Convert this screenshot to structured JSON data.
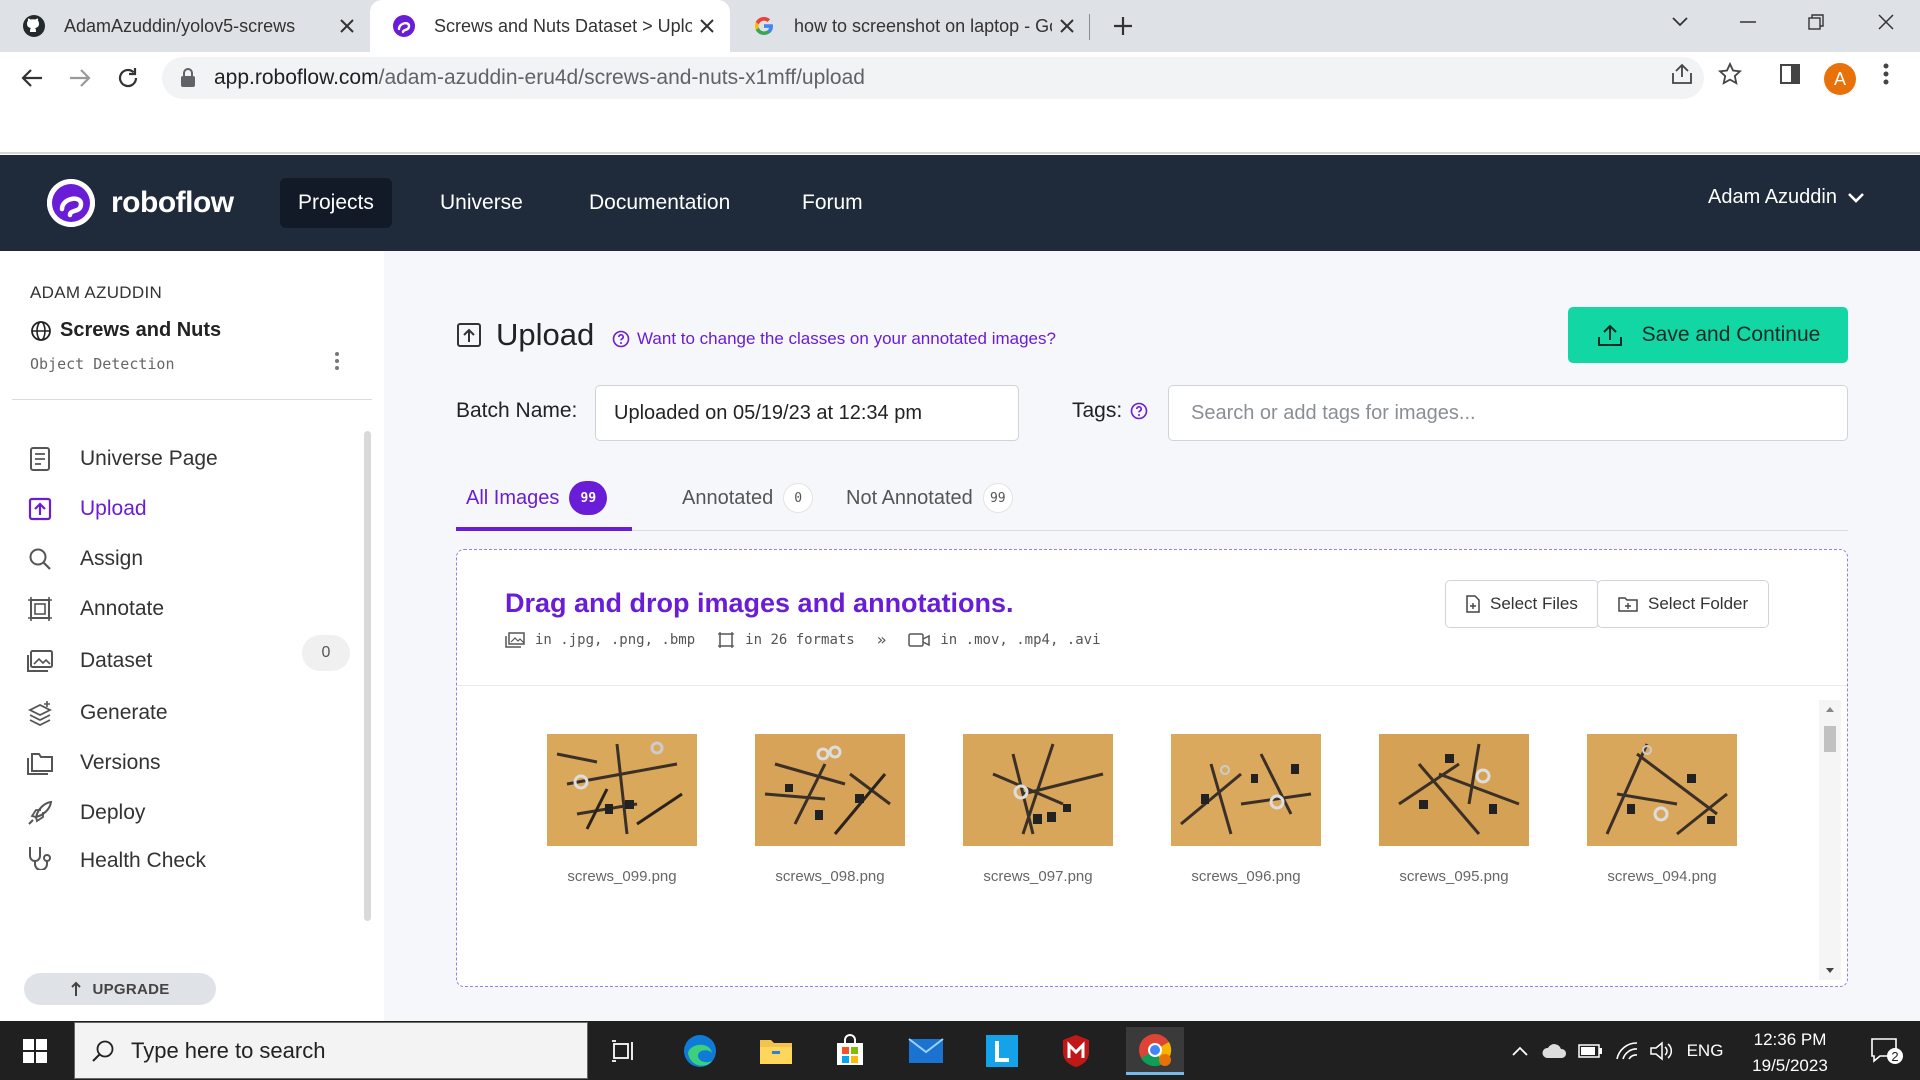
{
  "browser": {
    "tabs": [
      {
        "title": "AdamAzuddin/yolov5-screws",
        "icon": "github-icon"
      },
      {
        "title": "Screws and Nuts Dataset > Uplo…",
        "icon": "roboflow-icon"
      },
      {
        "title": "how to screenshot on laptop - Go",
        "icon": "google-icon"
      }
    ],
    "url_host": "app.roboflow.com",
    "url_path": "/adam-azuddin-eru4d/screws-and-nuts-x1mff/upload",
    "profile_initial": "A"
  },
  "nav": {
    "brand": "roboflow",
    "links": [
      "Projects",
      "Universe",
      "Documentation",
      "Forum"
    ],
    "user": "Adam Azuddin"
  },
  "sidebar": {
    "owner": "ADAM AZUDDIN",
    "project": "Screws and Nuts",
    "project_type": "Object Detection",
    "items": [
      {
        "label": "Universe Page",
        "icon": "book-icon"
      },
      {
        "label": "Upload",
        "icon": "upload-icon"
      },
      {
        "label": "Assign",
        "icon": "search-icon"
      },
      {
        "label": "Annotate",
        "icon": "annotate-icon"
      },
      {
        "label": "Dataset",
        "icon": "images-icon",
        "badge": "0"
      },
      {
        "label": "Generate",
        "icon": "layers-icon"
      },
      {
        "label": "Versions",
        "icon": "folders-icon"
      },
      {
        "label": "Deploy",
        "icon": "rocket-icon"
      },
      {
        "label": "Health Check",
        "icon": "health-icon"
      }
    ],
    "upgrade": "UPGRADE"
  },
  "main": {
    "title": "Upload",
    "class_hint": "Want to change the classes on your annotated images?",
    "save_button": "Save and Continue",
    "batch_label": "Batch Name:",
    "batch_value": "Uploaded on 05/19/23 at 12:34 pm",
    "tags_label": "Tags:",
    "tags_placeholder": "Search or add tags for images...",
    "tabs": [
      {
        "label": "All Images",
        "count": "99"
      },
      {
        "label": "Annotated",
        "count": "0"
      },
      {
        "label": "Not Annotated",
        "count": "99"
      }
    ],
    "dropzone": {
      "title": "Drag and drop images and annotations.",
      "image_formats": "in .jpg, .png, .bmp",
      "annotation_formats": "in 26 formats",
      "chevron": "»",
      "video_formats": "in .mov, .mp4, .avi",
      "select_files": "Select Files",
      "select_folder": "Select Folder"
    },
    "images": [
      "screws_099.png",
      "screws_098.png",
      "screws_097.png",
      "screws_096.png",
      "screws_095.png",
      "screws_094.png"
    ]
  },
  "taskbar": {
    "search_placeholder": "Type here to search",
    "language": "ENG",
    "time": "12:36 PM",
    "date": "19/5/2023",
    "notifications": "2"
  }
}
